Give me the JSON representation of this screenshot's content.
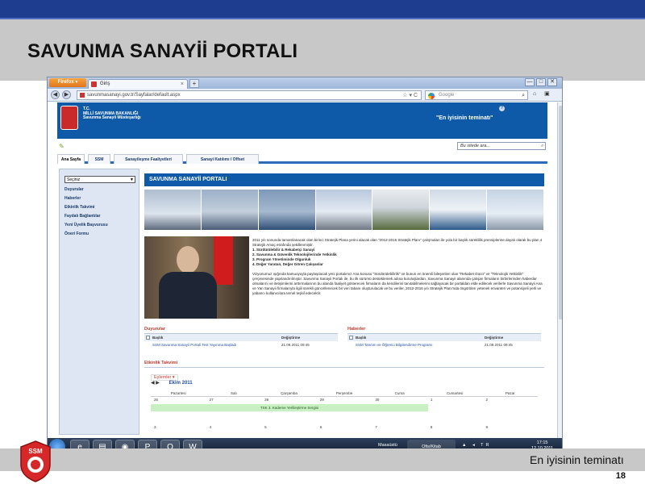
{
  "slide": {
    "title": "SAVUNMA SANAYİİ PORTALI",
    "slogan": "En iyisinin teminatı",
    "page_number": "18",
    "logo_text": "SSM"
  },
  "browser": {
    "app_button": "Firefox ▾",
    "tab_title": "Giriş",
    "new_tab": "+",
    "window_controls": [
      "—",
      "□",
      "✕"
    ],
    "url": "savunmasanayi.gov.tr/Sayfalar/default.aspx",
    "search_engine_label": "Google",
    "nav_icons": "⌂ ▣"
  },
  "site": {
    "header": {
      "ministry_line1": "T.C.",
      "ministry_line2": "MİLLİ SAVUNMA BAKANLIĞI",
      "ministry_line3": "Savunma Sanayii Müsteşarlığı",
      "slogan": "\"En iyisinin teminatı\"",
      "help": "?"
    },
    "search_placeholder": "Bu sitede ara...",
    "tabs": [
      "Ana Sayfa",
      "SSM",
      "Sanayileşme Faaliyetleri",
      "Sanayi Katılımı / Offset"
    ],
    "sidebar": {
      "select_value": "Seçiniz",
      "items": [
        "Duyurular",
        "Haberler",
        "Etkinlik Takvimi",
        "Faydalı Bağlantılar",
        "Yeni Üyelik Başvurusu",
        "Öneri Formu"
      ]
    },
    "portal_title": "SAVUNMA SANAYİİ PORTALI",
    "intro_text": "2011 yılı sonunda tamamlanacak olan birinci Stratejik Plana yerini alacak olan \"2012-2016 Stratejik Planı\" çalışmaları ile yola bir başlık süreklilik prensiplerine dayalı olarak bu plan 4 Stratejik Amaç etrafında şekillenmiştir.",
    "goals": [
      "1. Sürdürülebilir & Rekabetçi Sanayi",
      "2. Savunma & Güvenlik Teknolojilerinde Yetkinlik",
      "3. Program Yönetiminde Olgunluk",
      "4. Değer Yaratan, Değer Gören Çalışanlar"
    ],
    "paragraph": "Vizyonumuz ışığında kamuoyuyla paylaşılacak yeni portalımız Ana konusu \"Sürdürülebilirlik\" ve bunun en önemli bileşenleri olan \"Rekabet Gücü\" ve \"Teknolojik Yetkinlik\" çerçevesinde yapılandırılmıştır. Savunma Sanayii Portalı ile, bu ilk sürümü desteklemek adına kuruluşlardan, Savunma Sanayii alanında çalışan firmaların birbirlerinden haberdar olmalarını ve iletişimlerini arttırmalarının bu alanda faaliyet gösterecek firmaların da kendilerini tanıtabilmelerini sağlayacak bir portaldan elde edilecek verilerle Savunma Sanayii Ana ve Yan Sanayii firmalarıyla ilgili sürekli güncellenecek bir veri tabanı oluşturulacak ve bu veriler, 2012-2016 yılı Stratejik Planı'nda öngörülen yetenek envanteri ve potansiyeli yerli ve yabancı kullanıcılara temel teşkil edecektir.",
    "announcements": {
      "heading": "Duyurular",
      "col_title": "Başlık",
      "col_date": "Değiştirme",
      "item_title": "SSM Savunma Sanayii Portali Test Yayınına Başladı",
      "item_date": "21.09.2011 09:45"
    },
    "news": {
      "heading": "Haberler",
      "col_title": "Başlık",
      "col_date": "Değiştirme",
      "item_title": "SSM Tanıtım ve Öğrenci Bilgilendirme Programı",
      "item_date": "21.09.2011 09:45"
    },
    "calendar": {
      "heading": "Etkinlik Takvimi",
      "actions": "Eylemler ▾",
      "month": "Ekim 2011",
      "days": [
        "Pazartesi",
        "Salı",
        "Çarşamba",
        "Perşembe",
        "Cuma",
        "Cumartesi",
        "Pazar"
      ],
      "week1": [
        "26",
        "27",
        "28",
        "29",
        "30",
        "1",
        "2"
      ],
      "event": "TSK 3. Kademe Yerlileştirme Sergisi",
      "week2": [
        "3",
        "4",
        "5",
        "6",
        "7",
        "8",
        "9"
      ]
    }
  },
  "taskbar": {
    "icons": [
      "e",
      "▤",
      "◉",
      "P",
      "O",
      "W"
    ],
    "tray_label": "Masaüstü",
    "active_window": "Ofis/Kitab",
    "tray_icons": "▲ ◂ TR",
    "time": "17:15",
    "date": "12.10.2011"
  }
}
